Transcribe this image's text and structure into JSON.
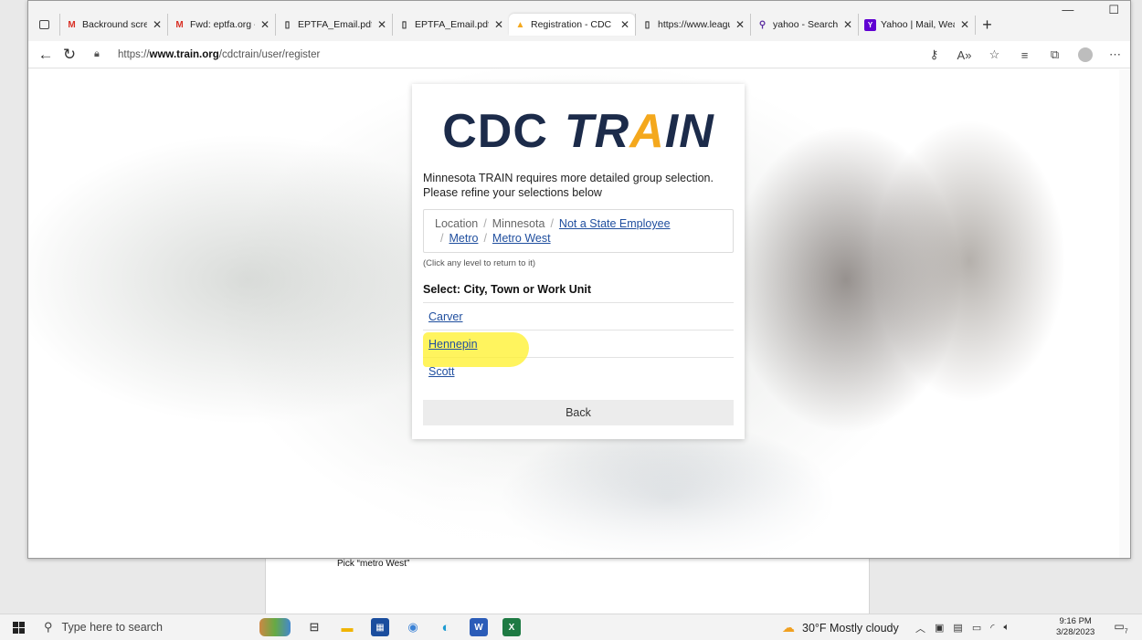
{
  "browser": {
    "tabs": [
      {
        "icon": "gmail-icon",
        "title": "Backround screen",
        "active": false
      },
      {
        "icon": "gmail-icon",
        "title": "Fwd: eptfa.org - N",
        "active": false
      },
      {
        "icon": "document-icon",
        "title": "EPTFA_Email.pdf",
        "active": false
      },
      {
        "icon": "document-icon",
        "title": "EPTFA_Email.pdf",
        "active": false
      },
      {
        "icon": "train-icon",
        "title": "Registration - CDC",
        "active": true
      },
      {
        "icon": "document-icon",
        "title": "https://www.leagu",
        "active": false
      },
      {
        "icon": "search-icon",
        "title": "yahoo - Search",
        "active": false
      },
      {
        "icon": "yahoo-icon",
        "title": "Yahoo | Mail, Wea",
        "active": false
      }
    ],
    "url_prefix": "https://",
    "url_domain": "www.train.org",
    "url_path": "/cdctrain/user/register"
  },
  "page": {
    "logo_left": "CDC",
    "logo_right_1": "TR",
    "logo_right_a": "A",
    "logo_right_2": "IN",
    "intro": "Minnesota TRAIN requires more detailed group selection. Please refine your selections below",
    "breadcrumb": {
      "location": "Location",
      "minnesota": "Minnesota",
      "not_state": "Not a State Employee",
      "metro": "Metro",
      "metro_west": "Metro West"
    },
    "hint": "(Click any level to return to it)",
    "select_title": "Select: City, Town or Work Unit",
    "options": [
      "Carver",
      "Hennepin",
      "Scott"
    ],
    "back_label": "Back"
  },
  "document": {
    "note": "Pick “metro West”"
  },
  "taskbar": {
    "search_placeholder": "Type here to search",
    "weather": "30°F  Mostly cloudy",
    "time": "9:16 PM",
    "date": "3/28/2023",
    "notifications": "7"
  }
}
